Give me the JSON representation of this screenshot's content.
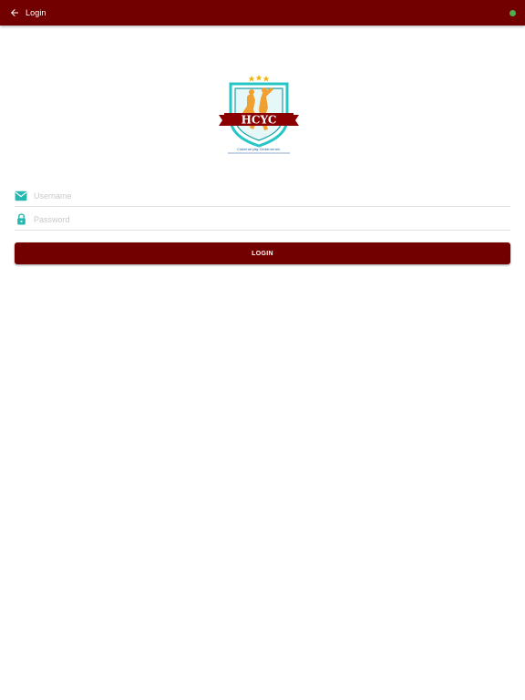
{
  "appbar": {
    "title": "Login",
    "back_icon": "arrow-left-icon",
    "status_color": "#4caf50"
  },
  "logo": {
    "text": "HCYC",
    "tagline": "Cricket we play. Cricket we win."
  },
  "form": {
    "username_placeholder": "Username",
    "password_placeholder": "Password",
    "username_icon": "mail-icon",
    "password_icon": "lock-icon"
  },
  "login_button": {
    "label": "LOGIN"
  },
  "colors": {
    "primary": "#730000",
    "accent": "#26b8b0",
    "logo_gold": "#f0a030"
  }
}
